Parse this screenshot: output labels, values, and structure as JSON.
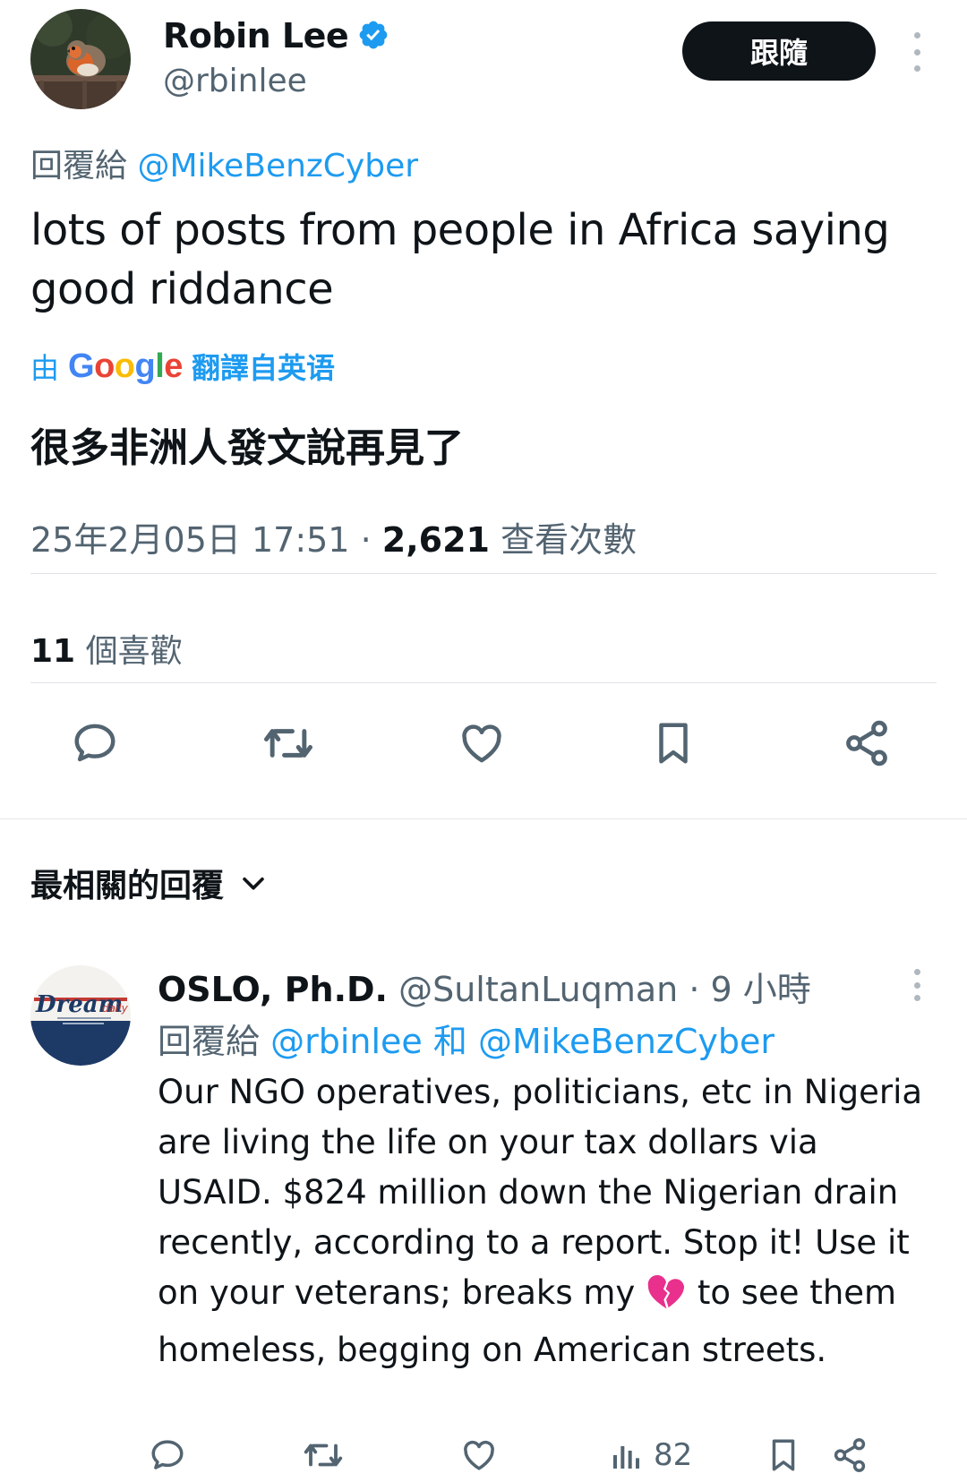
{
  "tweet": {
    "author_name": "Robin Lee",
    "author_handle": "@rbinlee",
    "follow_label": "跟隨",
    "reply_prefix": "回覆給",
    "reply_mention": "@MikeBenzCyber",
    "text": "lots of posts from people in Africa saying good riddance",
    "translate_prefix": "由",
    "translate_brand": "Google",
    "translate_suffix": "翻譯自英语",
    "translated_text": "很多非洲人發文說再見了",
    "timestamp": "25年2月05日 17:51",
    "separator": "·",
    "views_count": "2,621",
    "views_label": "查看次數",
    "likes_count": "11",
    "likes_label": "個喜歡"
  },
  "actions": {
    "icons": [
      "reply-icon",
      "retweet-icon",
      "like-icon",
      "bookmark-icon",
      "share-icon"
    ]
  },
  "replies_section": {
    "sort_label": "最相關的回覆"
  },
  "reply": {
    "author_name": "OSLO, Ph.D.",
    "author_handle": "@SultanLuqman",
    "time": "· 9 小時",
    "reply_prefix": "回覆給",
    "mention_1": "@rbinlee",
    "conj": "和",
    "mention_2": "@MikeBenzCyber",
    "text_before_emoji": "Our NGO operatives, politicians, etc in Nigeria are living the life on your tax dollars via USAID. $824 million down the Nigerian drain recently, according to a report. Stop it! Use it on your veterans; breaks my ",
    "emoji_name": "broken-heart-icon",
    "text_after_emoji": " to see them homeless, begging on American streets.",
    "avatar_text": "Dream",
    "avatar_small": "daily",
    "views_count": "82"
  },
  "colors": {
    "accent": "#1d9bf0",
    "text": "#0f1419",
    "secondary": "#536471",
    "button_bg": "#0f1419",
    "broken_heart": "#e8308c"
  }
}
